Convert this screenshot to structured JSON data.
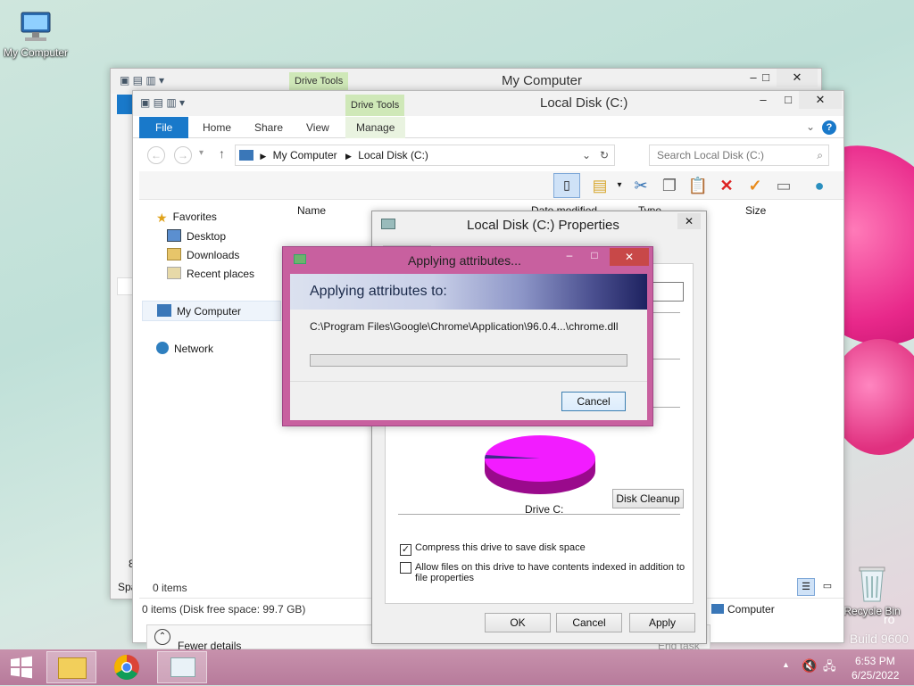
{
  "desktop": {
    "icons": [
      {
        "label": "My Computer"
      },
      {
        "label": "Recycle Bin"
      }
    ],
    "watermark": "Build 9600",
    "watermark_partial": "ro"
  },
  "back_window": {
    "title": "My Computer",
    "context_tab": "Drive Tools"
  },
  "main_window": {
    "title": "Local Disk (C:)",
    "context_tab": "Drive Tools",
    "tabs": [
      "File",
      "Home",
      "Share",
      "View",
      "Manage"
    ],
    "address": {
      "crumbs": [
        "My Computer",
        "Local Disk (C:)"
      ]
    },
    "search": {
      "placeholder": "Search Local Disk (C:)"
    },
    "columns": [
      "Name",
      "Date modified",
      "Type",
      "Size"
    ],
    "nav": {
      "favorites": "Favorites",
      "desktop": "Desktop",
      "downloads": "Downloads",
      "recent": "Recent places",
      "computer": "My Computer",
      "network": "Network"
    },
    "items_count": "0 items",
    "status_bar": "0 items (Disk free space: 99.7 GB)",
    "status_right": "Computer",
    "left_edge_fragments": [
      "8",
      "Spa"
    ]
  },
  "back_task": {
    "fewer_details": "Fewer details",
    "end_task": "End task"
  },
  "properties": {
    "title": "Local Disk (C:) Properties",
    "drive_label": "Drive C:",
    "disk_cleanup": "Disk Cleanup",
    "compress": {
      "label": "Compress this drive to save disk space",
      "checked": true
    },
    "index": {
      "label": "Allow files on this drive to have contents indexed in addition to file properties",
      "checked": false
    },
    "ok": "OK",
    "cancel": "Cancel",
    "apply": "Apply"
  },
  "applying": {
    "title": "Applying attributes...",
    "header": "Applying attributes to:",
    "path": "C:\\Program Files\\Google\\Chrome\\Application\\96.0.4...\\chrome.dll",
    "progress": 0,
    "cancel": "Cancel"
  },
  "taskbar": {
    "time": "6:53 PM",
    "date": "6/25/2022"
  },
  "colors": {
    "accent": "#1979ca",
    "dialog_frame": "#c8609f",
    "taskbar": "#be84a3",
    "pie_used": "#e0049c",
    "pie_free": "#f21cff"
  }
}
